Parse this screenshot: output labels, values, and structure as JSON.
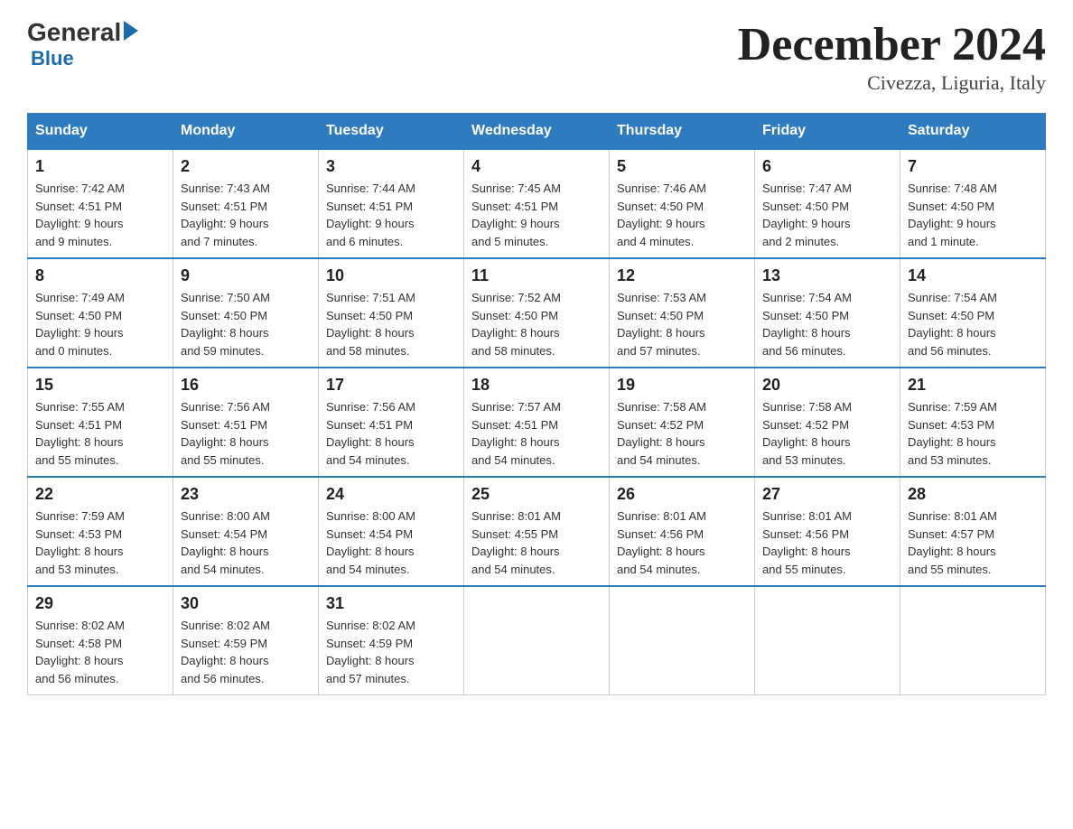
{
  "header": {
    "logo_general": "General",
    "logo_blue": "Blue",
    "month_title": "December 2024",
    "location": "Civezza, Liguria, Italy"
  },
  "days_of_week": [
    "Sunday",
    "Monday",
    "Tuesday",
    "Wednesday",
    "Thursday",
    "Friday",
    "Saturday"
  ],
  "weeks": [
    [
      {
        "day": "1",
        "info": "Sunrise: 7:42 AM\nSunset: 4:51 PM\nDaylight: 9 hours\nand 9 minutes."
      },
      {
        "day": "2",
        "info": "Sunrise: 7:43 AM\nSunset: 4:51 PM\nDaylight: 9 hours\nand 7 minutes."
      },
      {
        "day": "3",
        "info": "Sunrise: 7:44 AM\nSunset: 4:51 PM\nDaylight: 9 hours\nand 6 minutes."
      },
      {
        "day": "4",
        "info": "Sunrise: 7:45 AM\nSunset: 4:51 PM\nDaylight: 9 hours\nand 5 minutes."
      },
      {
        "day": "5",
        "info": "Sunrise: 7:46 AM\nSunset: 4:50 PM\nDaylight: 9 hours\nand 4 minutes."
      },
      {
        "day": "6",
        "info": "Sunrise: 7:47 AM\nSunset: 4:50 PM\nDaylight: 9 hours\nand 2 minutes."
      },
      {
        "day": "7",
        "info": "Sunrise: 7:48 AM\nSunset: 4:50 PM\nDaylight: 9 hours\nand 1 minute."
      }
    ],
    [
      {
        "day": "8",
        "info": "Sunrise: 7:49 AM\nSunset: 4:50 PM\nDaylight: 9 hours\nand 0 minutes."
      },
      {
        "day": "9",
        "info": "Sunrise: 7:50 AM\nSunset: 4:50 PM\nDaylight: 8 hours\nand 59 minutes."
      },
      {
        "day": "10",
        "info": "Sunrise: 7:51 AM\nSunset: 4:50 PM\nDaylight: 8 hours\nand 58 minutes."
      },
      {
        "day": "11",
        "info": "Sunrise: 7:52 AM\nSunset: 4:50 PM\nDaylight: 8 hours\nand 58 minutes."
      },
      {
        "day": "12",
        "info": "Sunrise: 7:53 AM\nSunset: 4:50 PM\nDaylight: 8 hours\nand 57 minutes."
      },
      {
        "day": "13",
        "info": "Sunrise: 7:54 AM\nSunset: 4:50 PM\nDaylight: 8 hours\nand 56 minutes."
      },
      {
        "day": "14",
        "info": "Sunrise: 7:54 AM\nSunset: 4:50 PM\nDaylight: 8 hours\nand 56 minutes."
      }
    ],
    [
      {
        "day": "15",
        "info": "Sunrise: 7:55 AM\nSunset: 4:51 PM\nDaylight: 8 hours\nand 55 minutes."
      },
      {
        "day": "16",
        "info": "Sunrise: 7:56 AM\nSunset: 4:51 PM\nDaylight: 8 hours\nand 55 minutes."
      },
      {
        "day": "17",
        "info": "Sunrise: 7:56 AM\nSunset: 4:51 PM\nDaylight: 8 hours\nand 54 minutes."
      },
      {
        "day": "18",
        "info": "Sunrise: 7:57 AM\nSunset: 4:51 PM\nDaylight: 8 hours\nand 54 minutes."
      },
      {
        "day": "19",
        "info": "Sunrise: 7:58 AM\nSunset: 4:52 PM\nDaylight: 8 hours\nand 54 minutes."
      },
      {
        "day": "20",
        "info": "Sunrise: 7:58 AM\nSunset: 4:52 PM\nDaylight: 8 hours\nand 53 minutes."
      },
      {
        "day": "21",
        "info": "Sunrise: 7:59 AM\nSunset: 4:53 PM\nDaylight: 8 hours\nand 53 minutes."
      }
    ],
    [
      {
        "day": "22",
        "info": "Sunrise: 7:59 AM\nSunset: 4:53 PM\nDaylight: 8 hours\nand 53 minutes."
      },
      {
        "day": "23",
        "info": "Sunrise: 8:00 AM\nSunset: 4:54 PM\nDaylight: 8 hours\nand 54 minutes."
      },
      {
        "day": "24",
        "info": "Sunrise: 8:00 AM\nSunset: 4:54 PM\nDaylight: 8 hours\nand 54 minutes."
      },
      {
        "day": "25",
        "info": "Sunrise: 8:01 AM\nSunset: 4:55 PM\nDaylight: 8 hours\nand 54 minutes."
      },
      {
        "day": "26",
        "info": "Sunrise: 8:01 AM\nSunset: 4:56 PM\nDaylight: 8 hours\nand 54 minutes."
      },
      {
        "day": "27",
        "info": "Sunrise: 8:01 AM\nSunset: 4:56 PM\nDaylight: 8 hours\nand 55 minutes."
      },
      {
        "day": "28",
        "info": "Sunrise: 8:01 AM\nSunset: 4:57 PM\nDaylight: 8 hours\nand 55 minutes."
      }
    ],
    [
      {
        "day": "29",
        "info": "Sunrise: 8:02 AM\nSunset: 4:58 PM\nDaylight: 8 hours\nand 56 minutes."
      },
      {
        "day": "30",
        "info": "Sunrise: 8:02 AM\nSunset: 4:59 PM\nDaylight: 8 hours\nand 56 minutes."
      },
      {
        "day": "31",
        "info": "Sunrise: 8:02 AM\nSunset: 4:59 PM\nDaylight: 8 hours\nand 57 minutes."
      },
      null,
      null,
      null,
      null
    ]
  ]
}
